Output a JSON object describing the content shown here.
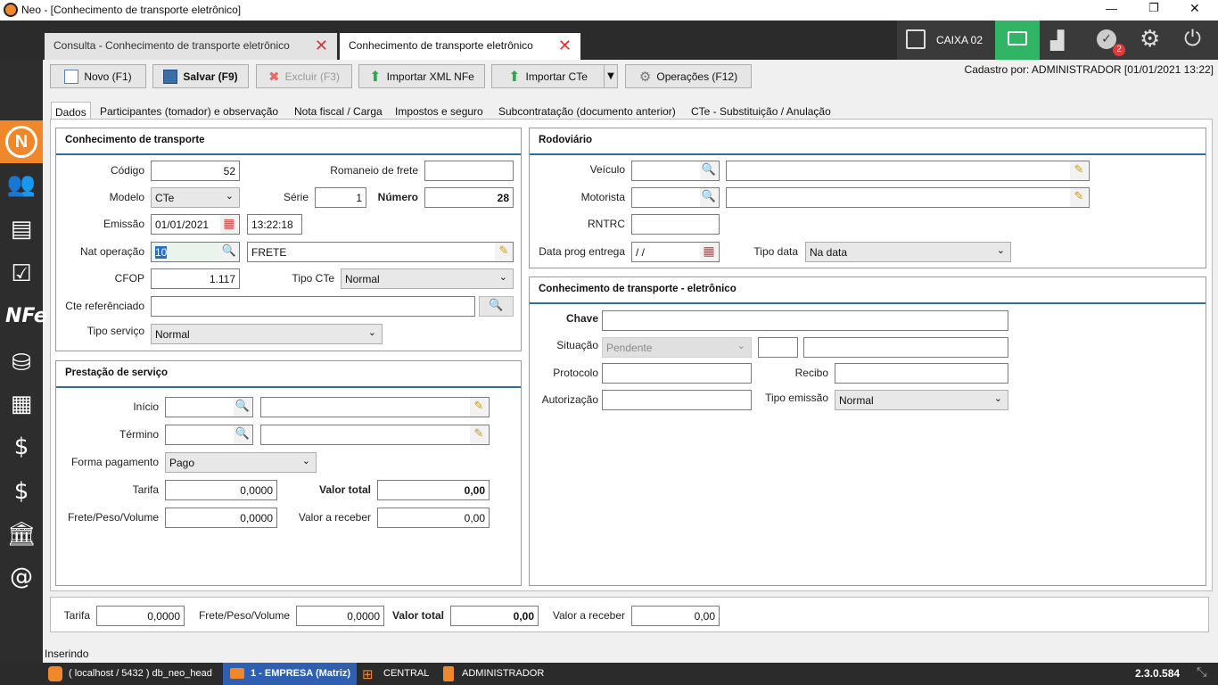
{
  "window": {
    "title": "Neo - [Conhecimento de transporte eletrônico]",
    "minimize": "—",
    "restore": "❐",
    "close": "✕"
  },
  "tabs": [
    {
      "label": "Consulta - Conhecimento de transporte eletrônico"
    },
    {
      "label": "Conhecimento de transporte eletrônico"
    }
  ],
  "topright": {
    "caixa": "CAIXA 02",
    "badge": "2"
  },
  "toolbar": {
    "novo": "Novo (F1)",
    "salvar": "Salvar (F9)",
    "excluir": "Excluir (F3)",
    "importar_xml": "Importar XML NFe",
    "importar_cte": "Importar CTe",
    "operacoes": "Operações (F12)"
  },
  "cadastro": "Cadastro por: ADMINISTRADOR [01/01/2021 13:22]",
  "form_tabs": [
    "Dados",
    "Participantes (tomador) e observação",
    "Nota fiscal / Carga",
    "Impostos e seguro",
    "Subcontratação (documento anterior)",
    "CTe - Substituição / Anulação"
  ],
  "ct": {
    "title": "Conhecimento de transporte",
    "codigo_l": "Código",
    "codigo": "52",
    "romaneio_l": "Romaneio de frete",
    "romaneio": "",
    "modelo_l": "Modelo",
    "modelo": "CTe",
    "serie_l": "Série",
    "serie": "1",
    "numero_l": "Número",
    "numero": "28",
    "emissao_l": "Emissão",
    "emissao_data": "01/01/2021",
    "emissao_hora": "13:22:18",
    "natop_l": "Nat operação",
    "natop_code": "10",
    "natop_desc": "FRETE",
    "cfop_l": "CFOP",
    "cfop": "1.117",
    "tipocte_l": "Tipo CTe",
    "tipocte": "Normal",
    "cteref_l": "Cte referênciado",
    "cteref": "",
    "tiposerv_l": "Tipo serviço",
    "tiposerv": "Normal"
  },
  "ps": {
    "title": "Prestação de serviço",
    "inicio_l": "Início",
    "termino_l": "Término",
    "formapag_l": "Forma pagamento",
    "formapag": "Pago",
    "tarifa_l": "Tarifa",
    "tarifa": "0,0000",
    "valortotal_l": "Valor total",
    "valortotal": "0,00",
    "frete_l": "Frete/Peso/Volume",
    "frete": "0,0000",
    "valorrec_l": "Valor a receber",
    "valorrec": "0,00"
  },
  "rod": {
    "title": "Rodoviário",
    "veiculo_l": "Veículo",
    "motorista_l": "Motorista",
    "rntrc_l": "RNTRC",
    "dataprog_l": "Data prog entrega",
    "dataprog": " / /",
    "tipodata_l": "Tipo data",
    "tipodata": "Na data"
  },
  "cte": {
    "title": "Conhecimento de transporte - eletrônico",
    "chave_l": "Chave",
    "situacao_l": "Situação",
    "situacao": "Pendente",
    "protocolo_l": "Protocolo",
    "recibo_l": "Recibo",
    "autorizacao_l": "Autorização",
    "tipoemissao_l": "Tipo emissão",
    "tipoemissao": "Normal"
  },
  "totals": {
    "tarifa_l": "Tarifa",
    "tarifa": "0,0000",
    "frete_l": "Frete/Peso/Volume",
    "frete": "0,0000",
    "valortotal_l": "Valor total",
    "valortotal": "0,00",
    "valorrec_l": "Valor a receber",
    "valorrec": "0,00"
  },
  "status": "Inserindo",
  "bottom": {
    "db": "( localhost / 5432 ) db_neo_head",
    "empresa": "1 - EMPRESA (Matriz)",
    "central": "CENTRAL",
    "user": "ADMINISTRADOR",
    "version": "2.3.0.584"
  },
  "icons": {
    "accent": "#f0872a",
    "green": "#2fb564"
  }
}
